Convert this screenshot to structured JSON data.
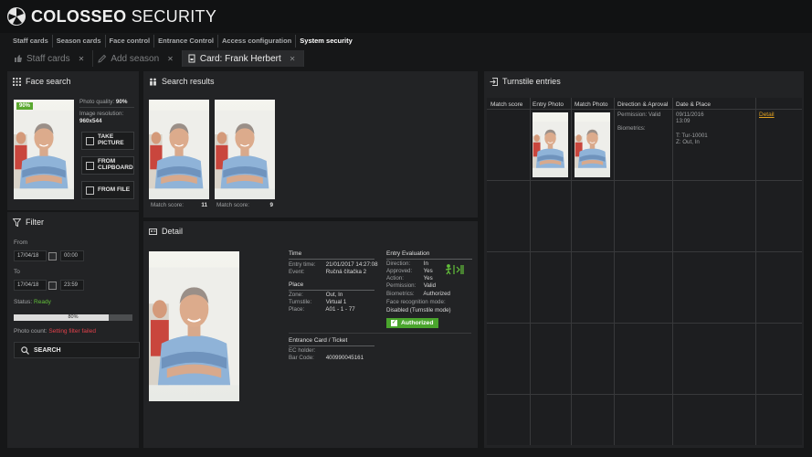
{
  "app": {
    "brand_bold": "COLOSSEO",
    "brand_light": "SECURITY"
  },
  "nav": [
    "Staff cards",
    "Season cards",
    "Face control",
    "Entrance Control",
    "Access configuration",
    "System security"
  ],
  "tabs": [
    {
      "label": "Staff cards",
      "icon": "thumbs-up-icon",
      "active": false
    },
    {
      "label": "Add season",
      "icon": "pencil-icon",
      "active": false
    },
    {
      "label": "Card: Frank Herbert",
      "icon": "badge-icon",
      "active": true
    }
  ],
  "face_search": {
    "title": "Face search",
    "badge": "90%",
    "quality_label": "Photo quality:",
    "quality_value": "90%",
    "resolution_label": "Image resolution:",
    "resolution_value": "960x544",
    "buttons": [
      {
        "line1": "TAKE",
        "line2": "PICTURE",
        "icon": "camera-icon"
      },
      {
        "line1": "FROM",
        "line2": "CLIPBOARD",
        "icon": "clipboard-icon"
      },
      {
        "line1": "FROM FILE",
        "line2": "",
        "icon": "file-icon"
      }
    ]
  },
  "filter": {
    "title": "Filter",
    "from_label": "From",
    "from_date": "17/04/18",
    "from_time": "00:00",
    "to_label": "To",
    "to_date": "17/04/18",
    "to_time": "23:59",
    "status_label": "Status:",
    "status_value": "Ready",
    "progress_text": "80%",
    "progress": 0.8,
    "photo_count_label": "Photo count:",
    "photo_count_value": "Setting filter failed",
    "search_label": "SEARCH"
  },
  "search_results": {
    "title": "Search results",
    "results": [
      {
        "label": "Match score:",
        "score": "11"
      },
      {
        "label": "Match score:",
        "score": "9"
      }
    ]
  },
  "detail": {
    "title": "Detail",
    "time": {
      "title": "Time",
      "entry_time_label": "Entry time:",
      "entry_time_value": "21/01/2017 14:27:08",
      "event_label": "Event:",
      "event_value": "Ručná čítačka 2"
    },
    "place": {
      "title": "Place",
      "zone_label": "Zone:",
      "zone_value": "Out, In",
      "turnstile_label": "Turnstile:",
      "turnstile_value": "Virtual 1",
      "place_label": "Place:",
      "place_value": "A01 - 1 - 77"
    },
    "evaluation": {
      "title": "Entry Evaluation",
      "direction_label": "Direction:",
      "direction_value": "In",
      "approved_label": "Approved:",
      "approved_value": "Yes",
      "action_label": "Action:",
      "action_value": "Yes",
      "permission_label": "Permission:",
      "permission_value": "Valid",
      "biometrics_label": "Biometrics:",
      "biometrics_value": "Authorized",
      "face_mode_label": "Face recognition mode:",
      "face_mode_value": "Disabled (Turnstile mode)",
      "badge": "Authorized"
    },
    "ticket": {
      "title": "Entrance Card / Ticket",
      "holder_label": "EC holder:",
      "holder_value": "",
      "barcode_label": "Bar Code:",
      "barcode_value": "400990045161"
    }
  },
  "turnstile": {
    "title": "Turnstile entries",
    "columns": [
      "Match score",
      "Entry Photo",
      "Match Photo",
      "Direction & Aproval",
      "Date & Place"
    ],
    "row": {
      "permission": "Permission: Valid",
      "biometrics": "Biometrics:",
      "date": "09/11/2016",
      "time": "13:09",
      "turnstile": "T: Tur-10001",
      "zone": "Z: Out, In",
      "link": "Detail"
    }
  },
  "colors": {
    "accent_green": "#5aa82f",
    "status_red": "#e0404a",
    "link_orange": "#e0a020"
  }
}
